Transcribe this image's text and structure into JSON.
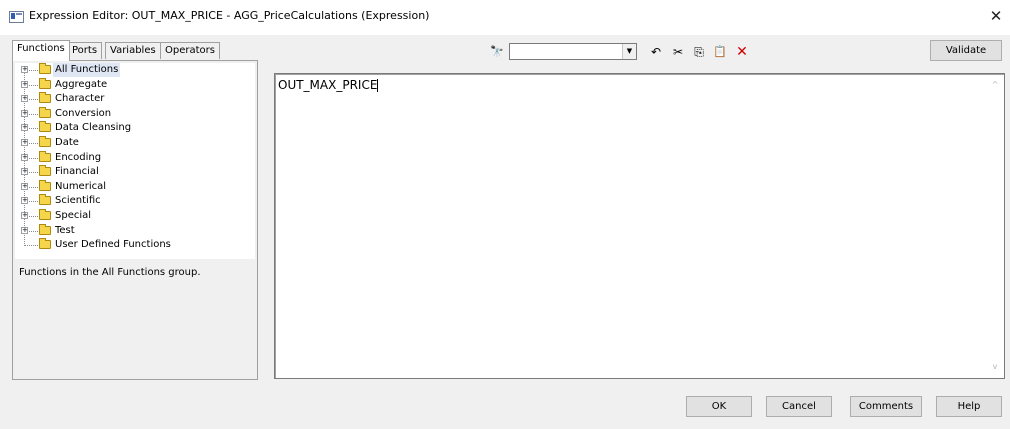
{
  "window": {
    "title": "Expression Editor: OUT_MAX_PRICE - AGG_PriceCalculations (Expression)",
    "close_glyph": "✕"
  },
  "tabs": [
    {
      "label": "Functions",
      "active": true
    },
    {
      "label": "Ports",
      "active": false
    },
    {
      "label": "Variables",
      "active": false
    },
    {
      "label": "Operators",
      "active": false
    }
  ],
  "tree": {
    "items": [
      {
        "label": "All Functions",
        "expandable": true,
        "selected": true
      },
      {
        "label": "Aggregate",
        "expandable": true
      },
      {
        "label": "Character",
        "expandable": true
      },
      {
        "label": "Conversion",
        "expandable": true
      },
      {
        "label": "Data Cleansing",
        "expandable": true
      },
      {
        "label": "Date",
        "expandable": true
      },
      {
        "label": "Encoding",
        "expandable": true
      },
      {
        "label": "Financial",
        "expandable": true
      },
      {
        "label": "Numerical",
        "expandable": true
      },
      {
        "label": "Scientific",
        "expandable": true
      },
      {
        "label": "Special",
        "expandable": true
      },
      {
        "label": "Test",
        "expandable": true
      },
      {
        "label": "User Defined Functions",
        "expandable": false
      }
    ],
    "expander_glyph": "+"
  },
  "description": "Functions in the All Functions group.",
  "toolbar": {
    "find_icon": "binoculars-icon",
    "find_glyph": "🔭",
    "search_value": "",
    "dropdown_glyph": "▼",
    "undo_icon": "undo-icon",
    "undo_glyph": "↶",
    "cut_icon": "scissors-icon",
    "cut_glyph": "✂",
    "copy_icon": "copy-icon",
    "copy_glyph": "⎘",
    "paste_icon": "paste-icon",
    "paste_glyph": "📋",
    "delete_icon": "delete-icon",
    "delete_glyph": "✕",
    "delete_color": "#d00000"
  },
  "validate_label": "Validate",
  "editor": {
    "text": "OUT_MAX_PRICE",
    "scroll_up_glyph": "^",
    "scroll_down_glyph": "v"
  },
  "buttons": {
    "ok": "OK",
    "cancel": "Cancel",
    "comments": "Comments",
    "help": "Help"
  }
}
